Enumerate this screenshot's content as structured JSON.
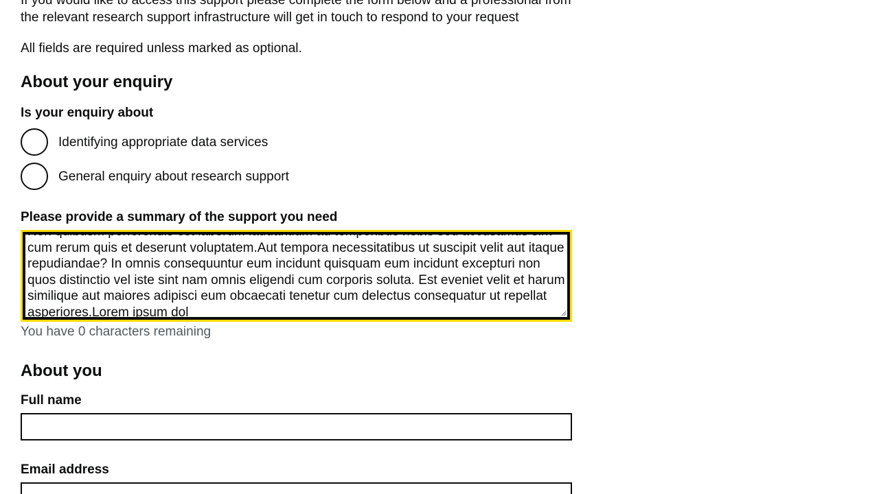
{
  "intro": {
    "line1": "If you would like to access this support please complete the form below and a professional from the relevant research support infrastructure will get in touch to respond to your request"
  },
  "required_note": "All fields are required unless marked as optional.",
  "enquiry_section": {
    "heading": "About your enquiry",
    "question": "Is your enquiry about",
    "options": [
      {
        "label": "Identifying appropriate data services",
        "selected": false
      },
      {
        "label": "General enquiry about research support",
        "selected": false
      }
    ]
  },
  "summary": {
    "label": "Please provide a summary of the support you need",
    "value": "Non quibusm perferendis est laborum laudantium ad temporibus nobis sed accusamus sint cum rerum quis et deserunt voluptatem.Aut tempora necessitatibus ut suscipit velit aut itaque repudiandae? In omnis consequuntur eum incidunt quisquam eum incidunt excepturi non quos distinctio vel iste sint nam omnis eligendi cum corporis soluta. Est eveniet velit et harum similique aut maiores adipisci eum obcaecati tenetur cum delectus consequatur ut repellat asperiores.Lorem ipsum dol",
    "hint": "You have 0 characters remaining"
  },
  "about_you": {
    "heading": "About you",
    "full_name_label": "Full name",
    "full_name_value": "",
    "email_label": "Email address",
    "email_value": ""
  },
  "colors": {
    "focus": "#ffdd00",
    "text": "#0b0c0c",
    "hint": "#505a5f"
  }
}
